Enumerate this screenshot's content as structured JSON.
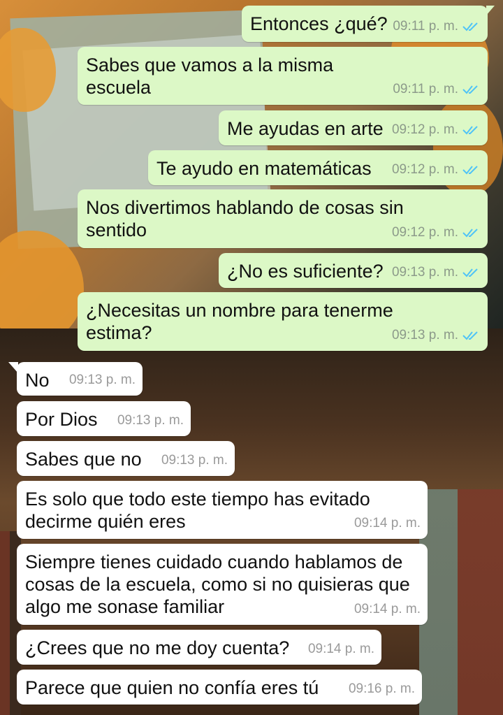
{
  "colors": {
    "outgoing_bubble": "#dcf8c6",
    "incoming_bubble": "#ffffff",
    "read_ticks": "#4fc3f7",
    "timestamp": "#8c9a8a"
  },
  "messages": [
    {
      "direction": "out",
      "text": "Entonces ¿qué?",
      "time": "09:11 p. m.",
      "status": "read"
    },
    {
      "direction": "out",
      "text": "Sabes que vamos a la misma\nescuela",
      "time": "09:11 p. m.",
      "status": "read"
    },
    {
      "direction": "out",
      "text": "Me ayudas en arte",
      "time": "09:12 p. m.",
      "status": "read"
    },
    {
      "direction": "out",
      "text": "Te ayudo en matemáticas",
      "time": "09:12 p. m.",
      "status": "read"
    },
    {
      "direction": "out",
      "text": "Nos divertimos hablando de cosas sin\nsentido",
      "time": "09:12 p. m.",
      "status": "read"
    },
    {
      "direction": "out",
      "text": "¿No es suficiente?",
      "time": "09:13 p. m.",
      "status": "read"
    },
    {
      "direction": "out",
      "text": "¿Necesitas un nombre para tenerme\nestima?",
      "time": "09:13 p. m.",
      "status": "read"
    },
    {
      "direction": "in",
      "text": "No",
      "time": "09:13 p. m."
    },
    {
      "direction": "in",
      "text": "Por Dios",
      "time": "09:13 p. m."
    },
    {
      "direction": "in",
      "text": "Sabes que no",
      "time": "09:13 p. m."
    },
    {
      "direction": "in",
      "text": "Es solo que todo este tiempo has evitado\ndecirme quién eres",
      "time": "09:14 p. m."
    },
    {
      "direction": "in",
      "text": "Siempre tienes cuidado cuando hablamos de\ncosas de la escuela, como si no quisieras que\nalgo me sonase familiar",
      "time": "09:14 p. m."
    },
    {
      "direction": "in",
      "text": "¿Crees que no me doy cuenta?",
      "time": "09:14 p. m."
    },
    {
      "direction": "in",
      "text": "Parece que quien no confía eres tú",
      "time": "09:16 p. m."
    }
  ]
}
